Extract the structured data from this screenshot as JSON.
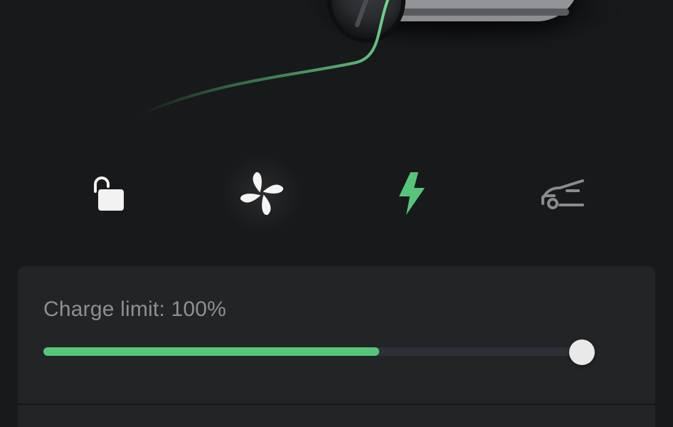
{
  "colors": {
    "background": "#18191b",
    "panel": "#232426",
    "accent_green": "#56c57a",
    "icon_white": "#f2f2f2",
    "icon_gray": "#8a8b8e",
    "label_gray": "#8e8f92"
  },
  "car": {
    "icon": "car-image"
  },
  "controls": [
    {
      "name": "lock",
      "icon": "unlocked-padlock-icon",
      "state": "unlocked"
    },
    {
      "name": "climate",
      "icon": "fan-icon",
      "state": "highlighted"
    },
    {
      "name": "charge",
      "icon": "lightning-bolt-icon",
      "state": "active"
    },
    {
      "name": "frunk",
      "icon": "frunk-open-icon",
      "state": "inactive"
    }
  ],
  "charge": {
    "label": "Charge limit: 100%",
    "limit_percent": 100,
    "current_level_percent": 61
  }
}
